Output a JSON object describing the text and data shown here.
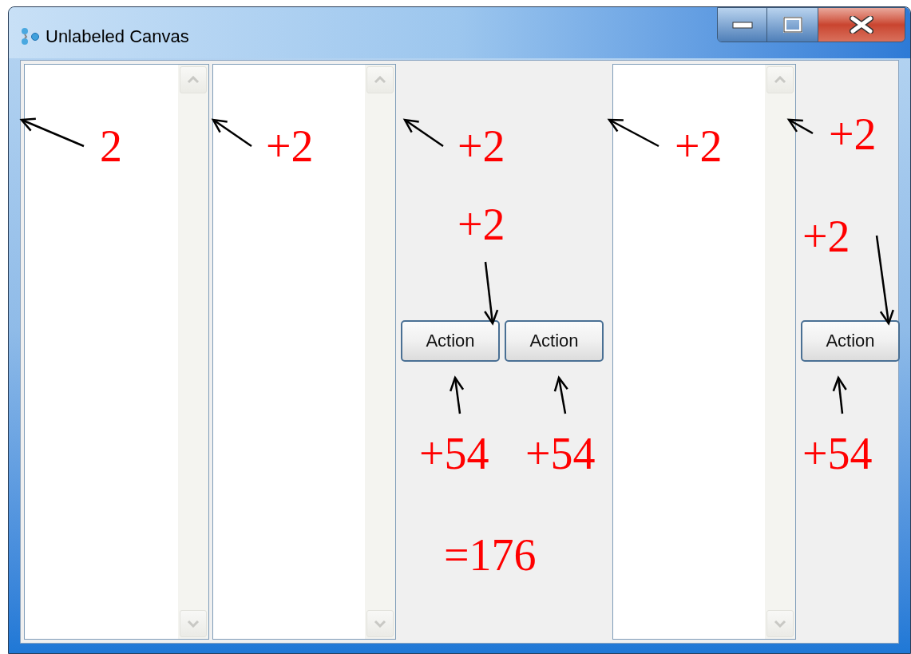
{
  "window": {
    "title": "Unlabeled Canvas"
  },
  "columns": [
    {
      "kind": "listbox"
    },
    {
      "kind": "listbox"
    },
    {
      "kind": "panel",
      "buttons": [
        "Action",
        "Action"
      ]
    },
    {
      "kind": "listbox"
    },
    {
      "kind": "panel",
      "buttons": [
        "Action"
      ]
    }
  ],
  "annotations": [
    "2",
    "+2",
    "+2",
    "+2",
    "+2",
    "+2",
    "+2",
    "+54",
    "+54",
    "+54",
    "=176"
  ]
}
